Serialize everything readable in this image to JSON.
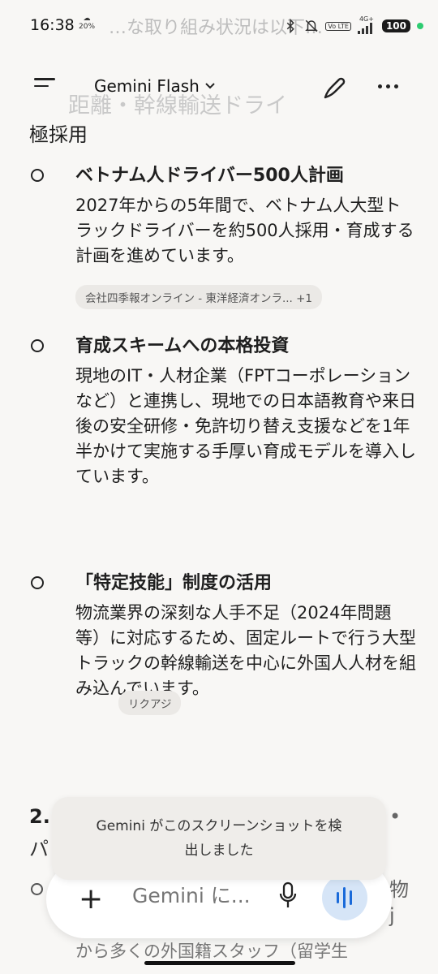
{
  "status_bar": {
    "time": "16:38",
    "weather": "20%",
    "background_text": "…な取り組み状況は以下…",
    "network": "4G+",
    "volte": "Vo LTE",
    "battery": "100"
  },
  "app_bar": {
    "model_name": "Gemini Flash",
    "background_text": "距離・幹線輸送ドライ"
  },
  "content": {
    "lead_text": "極採用",
    "items": [
      {
        "title": "ベトナム人ドライバー500人計画",
        "body": "2027年からの5年間で、ベトナム人大型トラックドライバーを約500人採用・育成する計画を進めています。",
        "source_chip": "会社四季報オンライン - 東洋経済オンラ... +1"
      },
      {
        "title": "育成スキームへの本格投資",
        "body": "現地のIT・人材企業（FPTコーポレーションなど）と連携し、現地での日本語教育や来日後の安全研修・免許切り替え支援などを1年半かけて実施する手厚い育成モデルを導入しています。"
      },
      {
        "title": "「特定技能」制度の活用",
        "body": "物流業界の深刻な人手不足（2024年問題等）に対応するため、固定ルートで行う大型トラックの幹線輸送を中心に外国人人材を組み込んでいます。",
        "source_chip": "リクアジ"
      }
    ],
    "section2_number": "2.",
    "section2_right": "•",
    "section2_line2": "パ",
    "obscured_right_1": "物",
    "obscured_right_2": "j",
    "obscured_line": "から多くの外国籍スタッフ（留学生"
  },
  "toast": {
    "message_line1": "Gemini がこのスクリーンショットを検",
    "message_line2": "出しました"
  },
  "input_bar": {
    "placeholder": "Gemini に..."
  }
}
